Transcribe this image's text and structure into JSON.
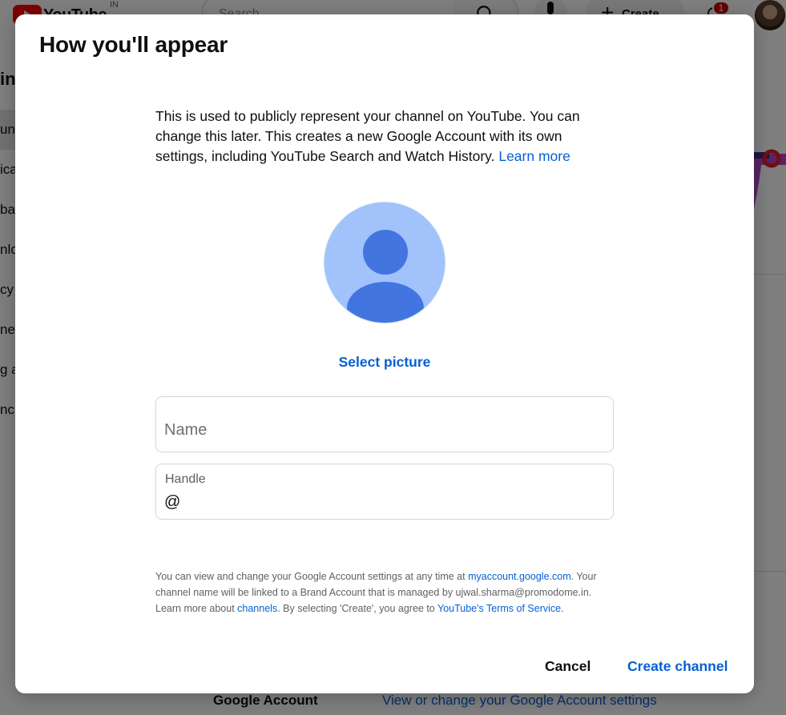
{
  "background": {
    "logo_text": "YouTube",
    "country_code": "IN",
    "search_placeholder": "Search",
    "create_label": "Create",
    "notification_count": "1",
    "sidebar_fragments": [
      "in",
      "un",
      "ica",
      "bac",
      "nlo",
      "cy",
      "nec",
      "g a",
      "nc"
    ],
    "bottom_section_label": "Google Account",
    "bottom_section_link": "View or change your Google Account settings"
  },
  "dialog": {
    "title": "How you'll appear",
    "intro_text": "This is used to publicly represent your channel on YouTube. You can change this later. This creates a new Google Account with its own settings, including YouTube Search and Watch History. ",
    "intro_link": "Learn more",
    "select_picture_label": "Select picture",
    "name_field": {
      "placeholder": "Name",
      "value": ""
    },
    "handle_field": {
      "label": "Handle",
      "prefix": "@",
      "value": ""
    },
    "fine_print": {
      "part1": "You can view and change your Google Account settings at any time at ",
      "link1": "myaccount.google.com",
      "part2": ". Your channel name will be linked to a Brand Account that is managed by ujwal.sharma@promodome.in. Learn more about ",
      "link2": "channels",
      "part3": ". By selecting 'Create', you agree to ",
      "link3": "YouTube's Terms of Service",
      "part4": "."
    },
    "cancel_label": "Cancel",
    "create_label": "Create channel"
  },
  "colors": {
    "link_blue": "#065fd4",
    "avatar_light": "#a1c2fa",
    "avatar_dark": "#4375e0",
    "scrim": "rgba(0,0,0,0.5)"
  }
}
